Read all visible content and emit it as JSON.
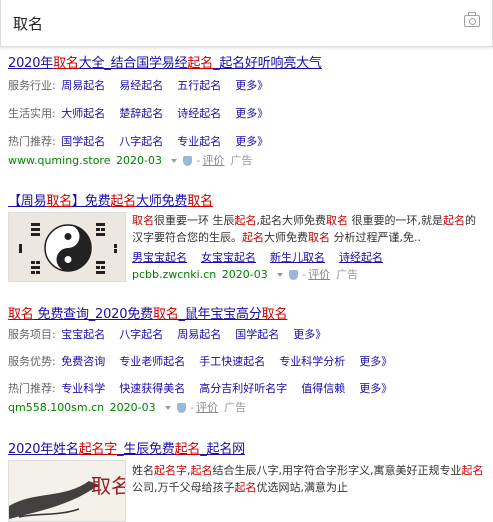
{
  "search": {
    "query": "取名"
  },
  "icons": {
    "camera": "camera-icon",
    "shield": "shield-icon",
    "chevron": "chevron-down-icon"
  },
  "r1": {
    "title": [
      "2020年",
      "取名",
      "大全_结合国学易经",
      "起名",
      "_起名好听响亮大气"
    ],
    "rows": [
      {
        "label": "服务行业:",
        "links": [
          "周易起名",
          "易经起名",
          "五行起名",
          "更多》"
        ]
      },
      {
        "label": "生活实用:",
        "links": [
          "大师起名",
          "楚辞起名",
          "诗经起名",
          "更多》"
        ]
      },
      {
        "label": "热门推荐:",
        "links": [
          "国学起名",
          "八字起名",
          "专业起名",
          "更多》"
        ]
      }
    ],
    "url": "www.quming.store",
    "date": "2020-03",
    "rate": "评价",
    "ad": "广告"
  },
  "r2": {
    "title": [
      "【周易",
      "取名",
      "】免费",
      "起名",
      "大师免费",
      "取名"
    ],
    "desc": [
      "取名",
      "很重要一环 生辰",
      "起名",
      ",起名大师免费",
      "取名",
      " 很重要的一环,就是",
      "起名",
      "的汉字要符合您的生辰。",
      "起名",
      "大师免费",
      "取名",
      " 分析过程严谨,免.."
    ],
    "sublinks": [
      "男宝宝起名",
      "女宝宝起名",
      "新生儿取名",
      "诗经起名"
    ],
    "url": "pcbb.zwcnki.cn",
    "date": "2020-03",
    "rate": "评价",
    "ad": "广告"
  },
  "r3": {
    "title": [
      "取名",
      " 免费查询_2020免费",
      "取名",
      "_鼠年宝宝高分",
      "取名"
    ],
    "rows": [
      {
        "label": "服务项目:",
        "links": [
          "宝宝起名",
          "八字起名",
          "周易起名",
          "国学起名",
          "更多》"
        ]
      },
      {
        "label": "服务优势:",
        "links": [
          "免费咨询",
          "专业老师起名",
          "手工快速起名",
          "专业科学分析",
          "更多》"
        ]
      },
      {
        "label": "热门推荐:",
        "links": [
          "专业科学",
          "快速获得美名",
          "高分吉利好听名字",
          "值得信赖",
          "更多》"
        ]
      }
    ],
    "url": "qm558.100sm.cn",
    "date": "2020-03",
    "rate": "评价",
    "ad": "广告"
  },
  "r4": {
    "title": [
      "2020年姓名",
      "起名字",
      "_生辰免费",
      "起名",
      "_起名网"
    ],
    "desc": [
      "姓名",
      "起名字",
      ",",
      "起名",
      "结合生辰八字,用字符合字形字义,寓意美好正规专业",
      "起名",
      "公司,万千父母给孩子",
      "起名",
      "优选网站,满意为止"
    ],
    "thumb_text": "取名"
  }
}
